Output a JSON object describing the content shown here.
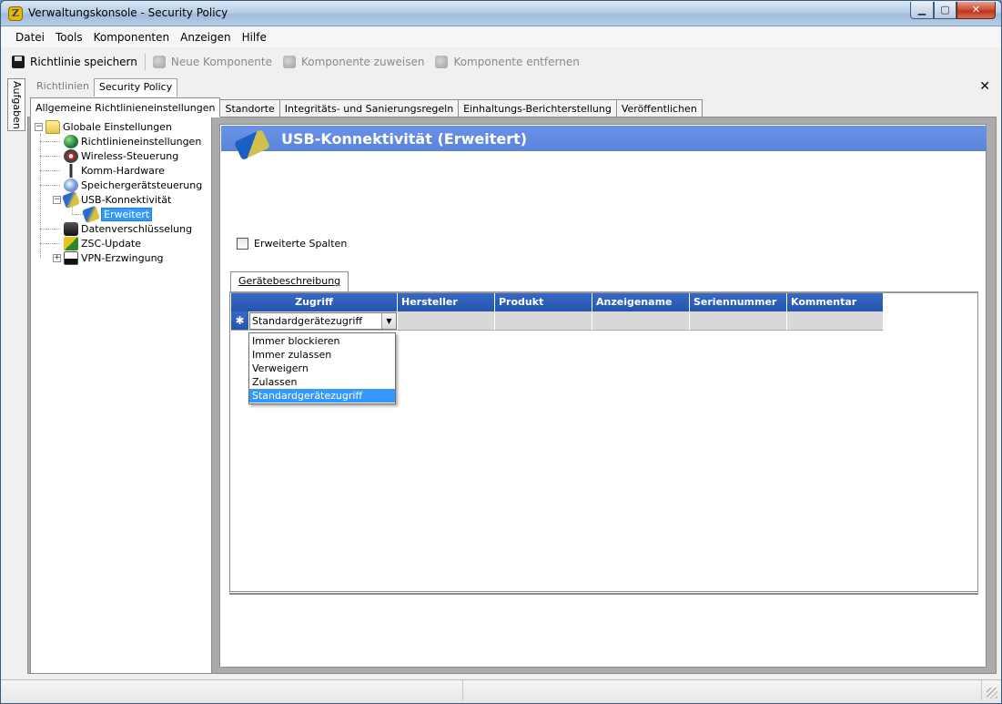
{
  "window": {
    "title": "Verwaltungskonsole - Security Policy"
  },
  "menu": [
    "Datei",
    "Tools",
    "Komponenten",
    "Anzeigen",
    "Hilfe"
  ],
  "toolbar": {
    "save": "Richtlinie speichern",
    "new_component": "Neue Komponente",
    "assign_component": "Komponente zuweisen",
    "remove_component": "Komponente entfernen"
  },
  "side_tab": "Aufgaben",
  "breadcrumb": {
    "root": "Richtlinien",
    "current": "Security Policy"
  },
  "tabs": [
    "Allgemeine Richtlinieneinstellungen",
    "Standorte",
    "Integritäts- und Sanierungsregeln",
    "Einhaltungs-Berichterstellung",
    "Veröffentlichen"
  ],
  "tree": {
    "root": "Globale Einstellungen",
    "items": [
      "Richtlinieneinstellungen",
      "Wireless-Steuerung",
      "Komm-Hardware",
      "Speichergerätsteuerung",
      "USB-Konnektivität",
      "Erweitert",
      "Datenverschlüsselung",
      "ZSC-Update",
      "VPN-Erzwingung"
    ]
  },
  "content": {
    "header": "USB-Konnektivität (Erweitert)",
    "checkbox_label": "Erweiterte Spalten",
    "subtab": "Gerätebeschreibung",
    "columns": [
      "Zugriff",
      "Hersteller",
      "Produkt",
      "Anzeigename",
      "Seriennummer",
      "Kommentar"
    ],
    "row_marker": "✱",
    "combo_value": "Standardgerätezugriff",
    "dropdown_options": [
      "Immer blockieren",
      "Immer zulassen",
      "Verweigern",
      "Zulassen",
      "Standardgerätezugriff"
    ],
    "dropdown_selected": "Standardgerätezugriff"
  },
  "colors": {
    "header_blue": "#6a92e6",
    "grid_header": "#2456b0",
    "selection": "#3399ff"
  }
}
